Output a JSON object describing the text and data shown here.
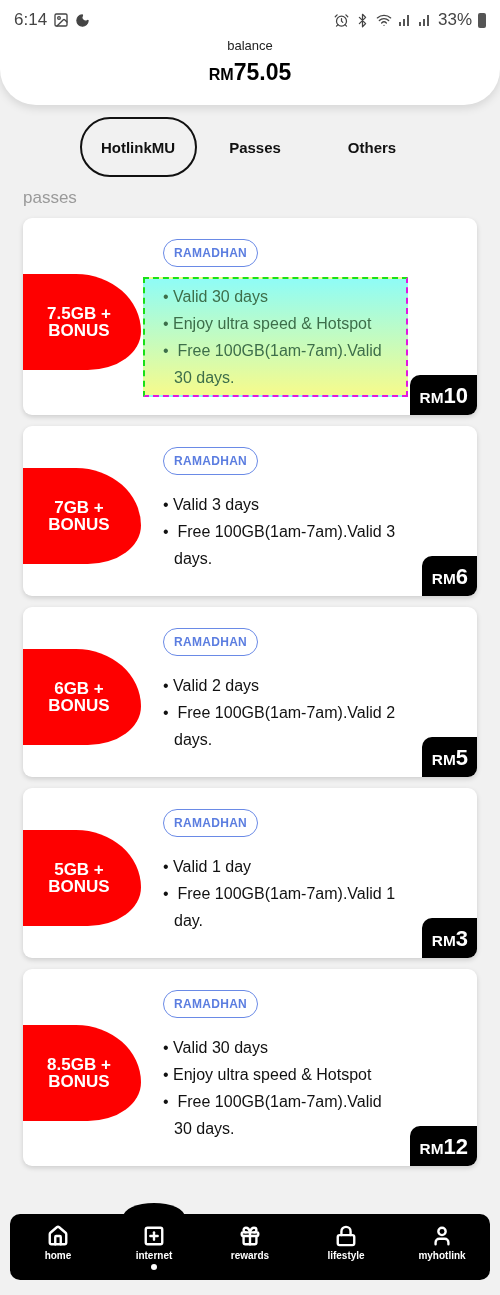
{
  "status_bar": {
    "time": "6:14",
    "battery": "33%"
  },
  "balance": {
    "label": "balance",
    "currency": "RM",
    "amount": "75.05"
  },
  "tabs": [
    {
      "label": "HotlinkMU",
      "selected": true
    },
    {
      "label": "Passes",
      "selected": false
    },
    {
      "label": "Others",
      "selected": false
    }
  ],
  "section_title": "passes",
  "passes": [
    {
      "data": "7.5GB + BONUS",
      "tag": "RAMADHAN",
      "highlighted": true,
      "features": [
        "• Valid 30 days",
        "• Enjoy ultra speed & Hotspot",
        "•  Free 100GB(1am-7am).Valid 30 days."
      ],
      "price": {
        "currency": "RM",
        "amount": "10"
      }
    },
    {
      "data": "7GB + BONUS",
      "tag": "RAMADHAN",
      "highlighted": false,
      "features": [
        "• Valid 3 days",
        "•  Free 100GB(1am-7am).Valid 3 days."
      ],
      "price": {
        "currency": "RM",
        "amount": "6"
      }
    },
    {
      "data": "6GB + BONUS",
      "tag": "RAMADHAN",
      "highlighted": false,
      "features": [
        "• Valid 2 days",
        "•  Free 100GB(1am-7am).Valid 2 days."
      ],
      "price": {
        "currency": "RM",
        "amount": "5"
      }
    },
    {
      "data": "5GB + BONUS",
      "tag": "RAMADHAN",
      "highlighted": false,
      "features": [
        "• Valid 1 day",
        "•  Free 100GB(1am-7am).Valid 1 day."
      ],
      "price": {
        "currency": "RM",
        "amount": "3"
      }
    },
    {
      "data": "8.5GB + BONUS",
      "tag": "RAMADHAN",
      "highlighted": false,
      "features": [
        "• Valid 30 days",
        "• Enjoy ultra speed & Hotspot",
        "•  Free 100GB(1am-7am).Valid 30 days."
      ],
      "price": {
        "currency": "RM",
        "amount": "12"
      }
    }
  ],
  "nav": [
    {
      "kind": "home",
      "label": "home",
      "selected": false
    },
    {
      "kind": "internet",
      "label": "internet",
      "selected": true
    },
    {
      "kind": "rewards",
      "label": "rewards",
      "selected": false
    },
    {
      "kind": "lifestyle",
      "label": "lifestyle",
      "selected": false
    },
    {
      "kind": "profile",
      "label": "myhotlink",
      "selected": false
    }
  ]
}
